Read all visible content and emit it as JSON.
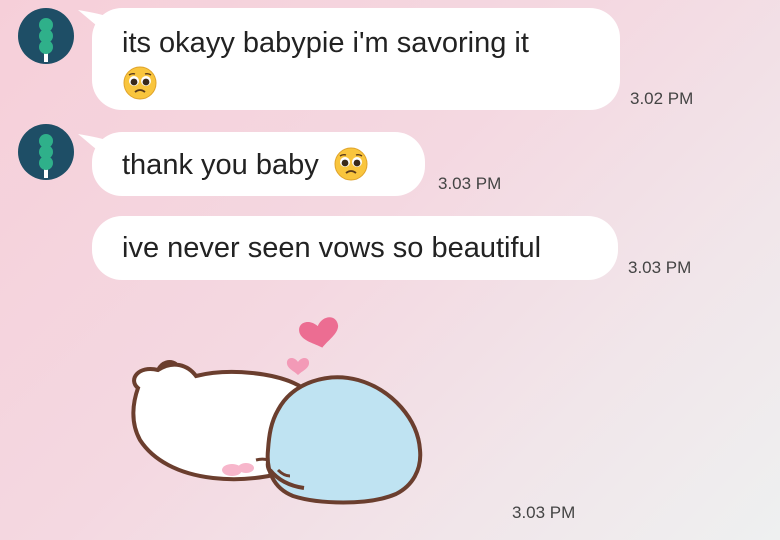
{
  "messages": [
    {
      "text": "its okayy babypie i'm savoring it",
      "emoji": "pleading-face",
      "time": "3.02 PM"
    },
    {
      "text": "thank you baby",
      "emoji": "pleading-face",
      "time": "3.03 PM"
    },
    {
      "text": "ive never seen vows so beautiful",
      "time": "3.03 PM"
    },
    {
      "sticker": "sleeping-bears-with-hearts",
      "time": "3.03 PM"
    }
  ],
  "avatar_icon": "dango-icon",
  "colors": {
    "avatar_bg": "#1e4e66",
    "avatar_glyph": "#2fb08a",
    "bubble": "#ffffff",
    "heart": "#ec6d92"
  }
}
